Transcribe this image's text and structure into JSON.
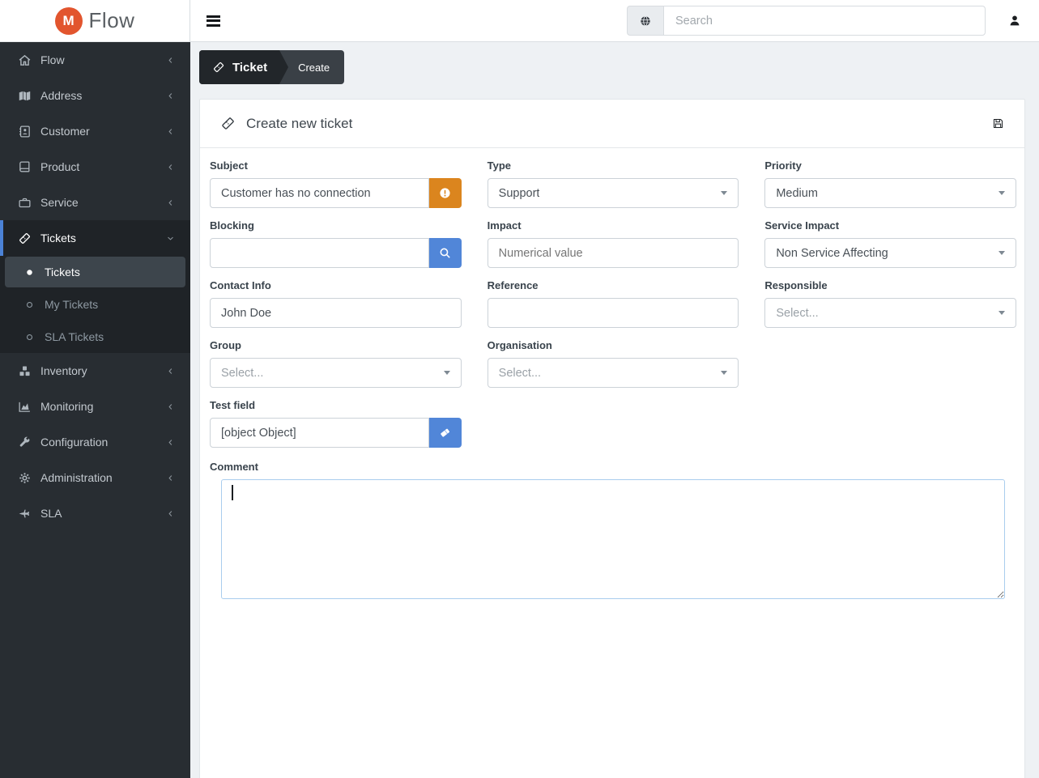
{
  "brand": {
    "app_name": "Flow",
    "logo_monogram": "M"
  },
  "topbar": {
    "search_placeholder": "Search"
  },
  "sidebar": {
    "items": [
      {
        "label": "Flow",
        "icon": "home-icon"
      },
      {
        "label": "Address",
        "icon": "map-icon"
      },
      {
        "label": "Customer",
        "icon": "address-book-icon"
      },
      {
        "label": "Product",
        "icon": "book-icon"
      },
      {
        "label": "Service",
        "icon": "briefcase-icon"
      },
      {
        "label": "Tickets",
        "icon": "ticket-icon",
        "expanded": true,
        "children": [
          {
            "label": "Tickets",
            "active": true
          },
          {
            "label": "My Tickets"
          },
          {
            "label": "SLA Tickets"
          }
        ]
      },
      {
        "label": "Inventory",
        "icon": "cubes-icon"
      },
      {
        "label": "Monitoring",
        "icon": "area-chart-icon"
      },
      {
        "label": "Configuration",
        "icon": "wrench-icon"
      },
      {
        "label": "Administration",
        "icon": "gear-icon"
      },
      {
        "label": "SLA",
        "icon": "jet-icon"
      }
    ]
  },
  "breadcrumb": {
    "section": "Ticket",
    "page": "Create"
  },
  "card": {
    "title": "Create new ticket"
  },
  "form": {
    "subject": {
      "label": "Subject",
      "value": "Customer has no connection"
    },
    "type": {
      "label": "Type",
      "value": "Support"
    },
    "priority": {
      "label": "Priority",
      "value": "Medium"
    },
    "blocking": {
      "label": "Blocking",
      "value": ""
    },
    "impact": {
      "label": "Impact",
      "placeholder": "Numerical value"
    },
    "service_impact": {
      "label": "Service Impact",
      "value": "Non Service Affecting"
    },
    "contact_info": {
      "label": "Contact Info",
      "value": "John Doe"
    },
    "reference": {
      "label": "Reference",
      "value": ""
    },
    "responsible": {
      "label": "Responsible",
      "placeholder": "Select..."
    },
    "group": {
      "label": "Group",
      "placeholder": "Select..."
    },
    "organisation": {
      "label": "Organisation",
      "placeholder": "Select..."
    },
    "test_field": {
      "label": "Test field",
      "value": "[object Object]"
    },
    "comment": {
      "label": "Comment",
      "value": ""
    }
  },
  "colors": {
    "logo_orange": "#e2552e",
    "accent_orange": "#db851e",
    "accent_blue": "#5186d8",
    "sidebar_bg": "#282d32",
    "sidebar_active_bg": "#3d454c",
    "sidebar_accent_bar": "#4b82d6",
    "breadcrumb_dark": "#22262a",
    "breadcrumb_light": "#3a4046",
    "content_bg": "#eef1f4",
    "comment_border": "#a9cdee"
  }
}
